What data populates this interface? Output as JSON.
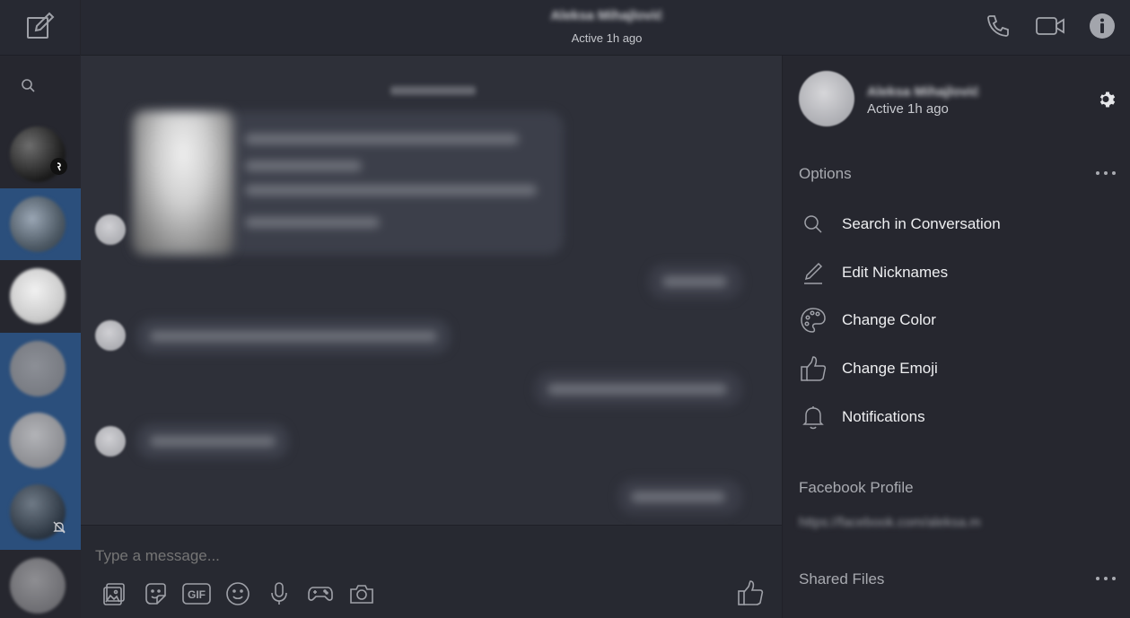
{
  "header": {
    "contact_name": "Aleksa Mihajlović",
    "status": "Active 1h ago"
  },
  "icons": {
    "compose": "compose-icon",
    "call": "phone-icon",
    "video": "video-camera-icon",
    "info": "info-icon",
    "search": "search-icon",
    "settings": "gear-icon",
    "more": "more-dots-icon"
  },
  "composer": {
    "placeholder": "Type a message...",
    "tools": [
      "image-icon",
      "sticker-icon",
      "gif-icon",
      "emoji-icon",
      "microphone-icon",
      "game-controller-icon",
      "camera-icon"
    ],
    "like_icon": "thumbs-up-icon"
  },
  "panel": {
    "contact_name": "Aleksa Mihajlović",
    "status": "Active 1h ago",
    "options_title": "Options",
    "options": [
      {
        "label": "Search in Conversation",
        "icon": "search-icon"
      },
      {
        "label": "Edit Nicknames",
        "icon": "pencil-icon"
      },
      {
        "label": "Change Color",
        "icon": "palette-icon"
      },
      {
        "label": "Change Emoji",
        "icon": "thumbs-up-icon"
      },
      {
        "label": "Notifications",
        "icon": "bell-icon"
      }
    ],
    "profile_title": "Facebook Profile",
    "profile_link": "https://facebook.com/aleksa.m",
    "shared_files_title": "Shared Files"
  },
  "colors": {
    "background": "#2b2d37",
    "sidebar": "#26272f",
    "selected": "#2b4f7c",
    "text": "#e6e7ea",
    "muted": "#a8aab0"
  }
}
